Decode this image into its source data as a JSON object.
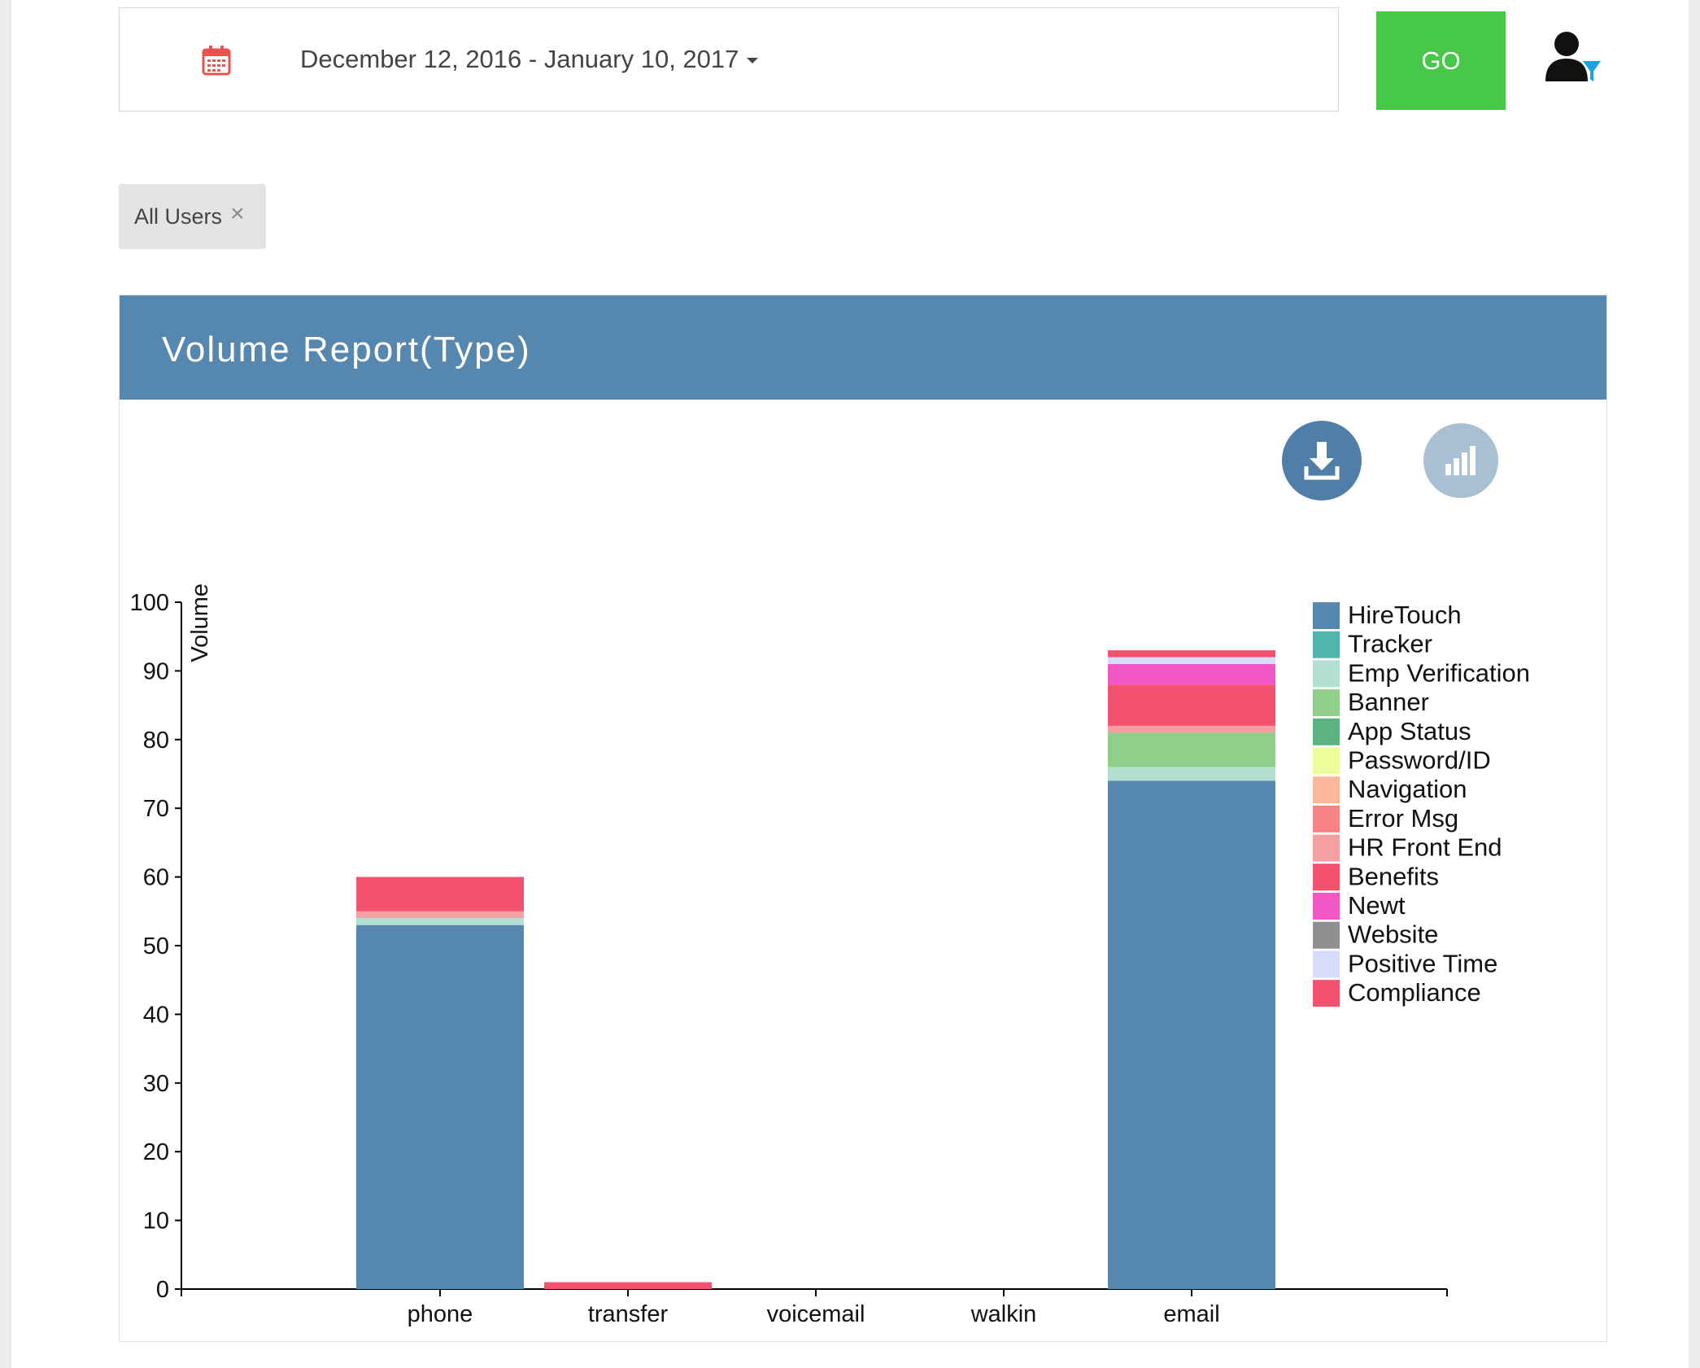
{
  "filter_bar": {
    "date_range": "December 12, 2016 - January 10, 2017",
    "go_label": "GO"
  },
  "chip": {
    "label": "All Users",
    "close": "×"
  },
  "report": {
    "title": "Volume Report(Type)"
  },
  "chart_data": {
    "type": "bar",
    "stacked": true,
    "categories": [
      "phone",
      "transfer",
      "voicemail",
      "walkin",
      "email"
    ],
    "ylabel": "Volume",
    "xlabel": "",
    "ylim": [
      0,
      100
    ],
    "yticks": [
      0,
      10,
      20,
      30,
      40,
      50,
      60,
      70,
      80,
      90,
      100
    ],
    "legend_position": "right",
    "series": [
      {
        "name": "HireTouch",
        "color": "#5687ae",
        "values": [
          53,
          0,
          0,
          0,
          74
        ]
      },
      {
        "name": "Tracker",
        "color": "#4fb6ab",
        "values": [
          0,
          0,
          0,
          0,
          0
        ]
      },
      {
        "name": "Emp Verification",
        "color": "#b2e0d2",
        "values": [
          1,
          0,
          0,
          0,
          2
        ]
      },
      {
        "name": "Banner",
        "color": "#8ecf8a",
        "values": [
          0,
          0,
          0,
          0,
          5
        ]
      },
      {
        "name": "App Status",
        "color": "#5bb380",
        "values": [
          0,
          0,
          0,
          0,
          0
        ]
      },
      {
        "name": "Password/ID",
        "color": "#eefd9c",
        "values": [
          0,
          0,
          0,
          0,
          0
        ]
      },
      {
        "name": "Navigation",
        "color": "#fdb69a",
        "values": [
          0,
          0,
          0,
          0,
          0
        ]
      },
      {
        "name": "Error Msg",
        "color": "#f78484",
        "values": [
          0,
          0,
          0,
          0,
          0
        ]
      },
      {
        "name": "HR Front End",
        "color": "#f4a0a0",
        "values": [
          1,
          0,
          0,
          0,
          1
        ]
      },
      {
        "name": "Benefits",
        "color": "#f3526e",
        "values": [
          5,
          1,
          0,
          0,
          6
        ]
      },
      {
        "name": "Newt",
        "color": "#f357c4",
        "values": [
          0,
          0,
          0,
          0,
          3
        ]
      },
      {
        "name": "Website",
        "color": "#8f8f8f",
        "values": [
          0,
          0,
          0,
          0,
          0
        ]
      },
      {
        "name": "Positive Time",
        "color": "#d6dcfb",
        "values": [
          0,
          0,
          0,
          0,
          1
        ]
      },
      {
        "name": "Compliance",
        "color": "#f3526e",
        "values": [
          0,
          0,
          0,
          0,
          1
        ]
      }
    ]
  },
  "colors": {
    "header": "#5687ae",
    "go_button": "#47c849",
    "calendar_icon": "#e8534c"
  },
  "icons": {
    "calendar": "calendar-icon",
    "user_filter": "user-filter-icon",
    "download": "download-icon",
    "chart": "bar-chart-icon",
    "close": "close-icon"
  }
}
